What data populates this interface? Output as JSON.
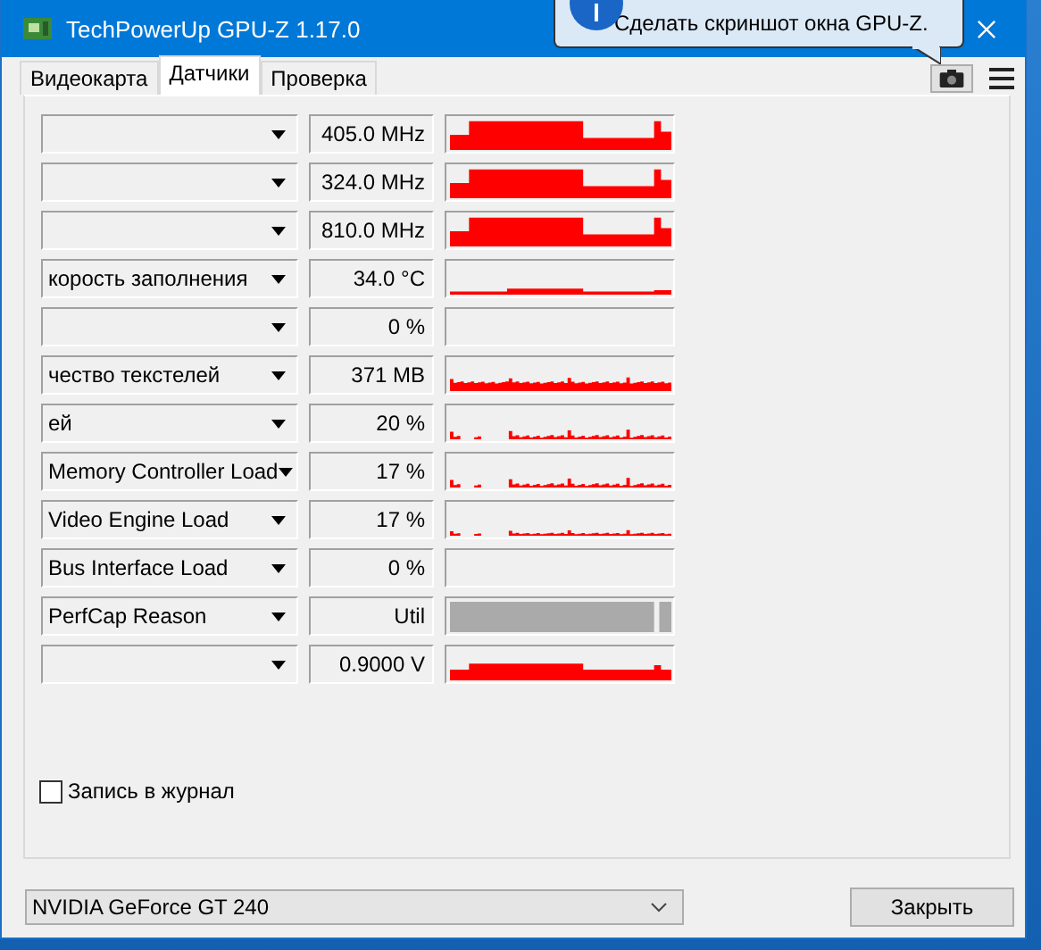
{
  "window": {
    "title": "TechPowerUp GPU-Z 1.17.0"
  },
  "tooltip": {
    "text": "Сделать скриншот окна GPU-Z."
  },
  "tabs": [
    {
      "label": "Видеокарта",
      "selected": false
    },
    {
      "label": "Датчики",
      "selected": true
    },
    {
      "label": "Проверка",
      "selected": false
    }
  ],
  "sensors": [
    {
      "value": "405.0 MHz",
      "kind": "clock"
    },
    {
      "value": "324.0 MHz",
      "kind": "clock"
    },
    {
      "value": "810.0 MHz",
      "kind": "clock"
    },
    {
      "name": "корость заполнения",
      "value": "34.0 °C",
      "kind": "low"
    },
    {
      "value": "0 %",
      "kind": "empty"
    },
    {
      "name": "чество текстелей",
      "value": "371 MB",
      "kind": "band"
    },
    {
      "name": "ей",
      "value": "20 %",
      "kind": "noisy"
    },
    {
      "name": "Memory Controller Load",
      "value": "17 %",
      "kind": "noisy"
    },
    {
      "name": "Video Engine Load",
      "value": "17 %",
      "kind": "sparse"
    },
    {
      "name": "Bus Interface Load",
      "value": "0 %",
      "kind": "empty"
    },
    {
      "name": "PerfCap Reason",
      "value": "Util",
      "kind": "perfcap"
    },
    {
      "value": "0.9000 V",
      "kind": "volt"
    }
  ],
  "log": {
    "label": "Запись в журнал",
    "checked": false
  },
  "gpu_select": {
    "value": "NVIDIA GeForce GT 240"
  },
  "close_button": "Закрыть"
}
